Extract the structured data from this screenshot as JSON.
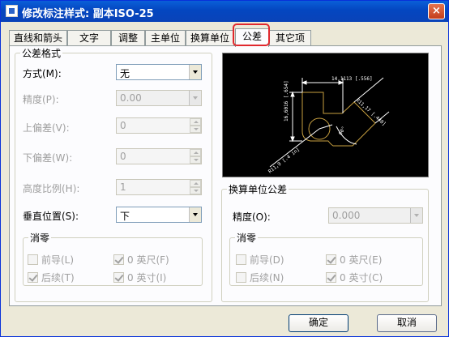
{
  "window": {
    "title": "修改标注样式: 副本ISO-25",
    "close_label": "×"
  },
  "tabs": [
    "直线和箭头",
    "文字",
    "调整",
    "主单位",
    "换算单位",
    "公差",
    "其它项"
  ],
  "tolerance_format": {
    "title": "公差格式",
    "method_label": "方式(M):",
    "method_value": "无",
    "precision_label": "精度(P):",
    "precision_value": "0.00",
    "upper_label": "上偏差(V):",
    "upper_value": "0",
    "lower_label": "下偏差(W):",
    "lower_value": "0",
    "height_label": "高度比例(H):",
    "height_value": "1",
    "vpos_label": "垂直位置(S):",
    "vpos_value": "下",
    "zero": {
      "title": "消零",
      "leading": "前导(L)",
      "feet": "0 英尺(F)",
      "trailing": "后续(T)",
      "inches": "0 英寸(I)"
    }
  },
  "alt_tolerance": {
    "title": "换算单位公差",
    "precision_label": "精度(O):",
    "precision_value": "0.000",
    "zero": {
      "title": "消零",
      "leading": "前导(D)",
      "feet": "0 英尺(E)",
      "trailing": "后续(N)",
      "inches": "0 英寸(C)"
    }
  },
  "preview": {
    "dim_top": "14,1113 [.556]",
    "dim_left": "16,6016 [.654]",
    "dim_right": "R11,17 [.440]",
    "dim_angle": "60°",
    "dim_diag": "R11,9 [.4 in]"
  },
  "buttons": {
    "ok": "确定",
    "cancel": "取消"
  }
}
